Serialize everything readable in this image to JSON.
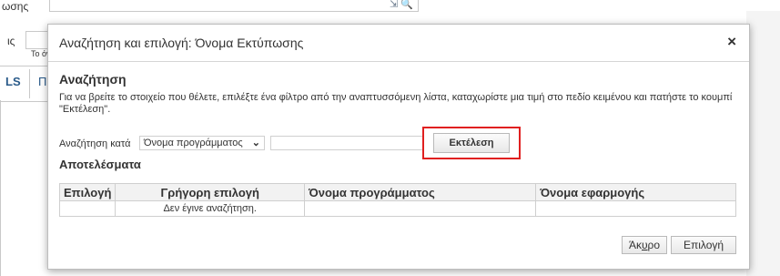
{
  "background": {
    "top_label": "ωσης",
    "search_glyph": "⇲ 🔍",
    "side_label": "ις",
    "hint": "Το όν",
    "tab_active": "LS",
    "tab_next": "Π"
  },
  "dialog": {
    "title": "Αναζήτηση και επιλογή: Όνομα Εκτύπωσης",
    "close_symbol": "×",
    "search_section_title": "Αναζήτηση",
    "instructions": "Για να βρείτε το στοιχείο που θέλετε, επιλέξτε ένα φίλτρο από την αναπτυσσόμενη λίστα, καταχωρίστε μια τιμή στο πεδίο κειμένου και πατήστε το κουμπί \"Εκτέλεση\".",
    "search_by_label": "Αναζήτηση κατά",
    "search_by_value": "Όνομα προγράμματος",
    "search_text_value": "",
    "execute_label": "Εκτέλεση",
    "results_title": "Αποτελέσματα",
    "columns": [
      "Επιλογή",
      "Γρήγορη επιλογή",
      "Όνομα προγράμματος",
      "Όνομα εφαρμογής"
    ],
    "empty_row": [
      "",
      "Δεν έγινε αναζήτηση.",
      "",
      ""
    ],
    "cancel_label_prefix": "Άκ",
    "cancel_label_underlined": "υ",
    "cancel_label_suffix": "ρο",
    "select_label": "Επιλογή",
    "highlight_color": "#e02020"
  }
}
